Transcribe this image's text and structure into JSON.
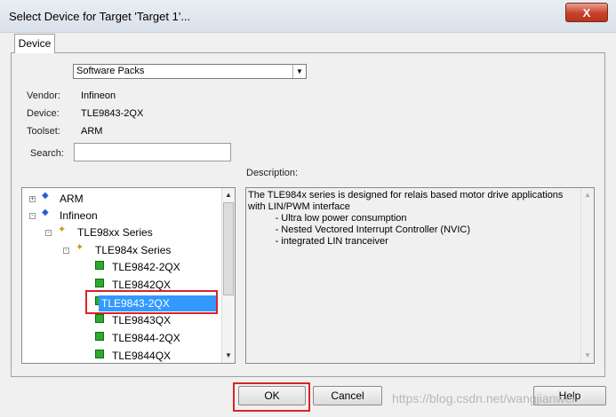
{
  "window": {
    "title": "Select Device for Target 'Target 1'...",
    "close_glyph": "X"
  },
  "tabs": [
    {
      "label": "Device",
      "active": true
    }
  ],
  "source_select": {
    "value": "Software Packs"
  },
  "info": {
    "vendor_label": "Vendor:",
    "vendor_value": "Infineon",
    "device_label": "Device:",
    "device_value": "TLE9843-2QX",
    "toolset_label": "Toolset:",
    "toolset_value": "ARM"
  },
  "search": {
    "label": "Search:",
    "value": ""
  },
  "description": {
    "label": "Description:",
    "text": "The TLE984x series is designed for relais based motor drive applications\nwith LIN/PWM interface\n          - Ultra low power consumption\n          - Nested Vectored Interrupt Controller (NVIC)\n          - integrated LIN tranceiver"
  },
  "tree": {
    "items": [
      {
        "label": "ARM",
        "level": 0,
        "icon": "vendor-gem-icon",
        "expander": "+"
      },
      {
        "label": "Infineon",
        "level": 0,
        "icon": "vendor-gem-icon",
        "expander": "-"
      },
      {
        "label": "TLE98xx Series",
        "level": 1,
        "icon": "series-icon",
        "expander": "-"
      },
      {
        "label": "TLE984x Series",
        "level": 2,
        "icon": "series-icon",
        "expander": "-"
      },
      {
        "label": "TLE9842-2QX",
        "level": 3,
        "icon": "chip-icon"
      },
      {
        "label": "TLE9842QX",
        "level": 3,
        "icon": "chip-icon"
      },
      {
        "label": "TLE9843-2QX",
        "level": 3,
        "icon": "chip-icon",
        "selected": true
      },
      {
        "label": "TLE9843QX",
        "level": 3,
        "icon": "chip-icon"
      },
      {
        "label": "TLE9844-2QX",
        "level": 3,
        "icon": "chip-icon"
      },
      {
        "label": "TLE9844QX",
        "level": 3,
        "icon": "chip-icon"
      }
    ]
  },
  "buttons": {
    "ok": "OK",
    "cancel": "Cancel",
    "help": "Help"
  },
  "watermark": "https://blog.csdn.net/wangjianwei",
  "colors": {
    "selection": "#3399ff",
    "highlight_box": "#d9232a",
    "chip": "#2faa2f",
    "gem": "#2a5bd7"
  }
}
